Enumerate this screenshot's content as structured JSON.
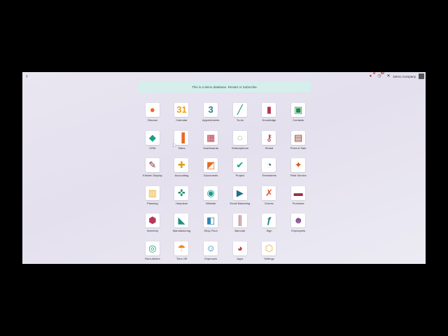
{
  "topbar": {
    "menu_icon": "chevron-right",
    "chat_badge": "6",
    "activity_badge": "12",
    "close_label": "✕",
    "company_name": "Demo Company"
  },
  "banner": {
    "text": "This is a demo database. Restart or Subscribe."
  },
  "apps": [
    {
      "label": "Discuss",
      "glyph": "●",
      "color": "#f26b21",
      "icon": "chat-bubble-icon"
    },
    {
      "label": "Calendar",
      "glyph": "31",
      "color": "#e8a01f",
      "icon": "calendar-icon"
    },
    {
      "label": "Appointments",
      "glyph": "3",
      "color": "#2a7d8c",
      "icon": "appointment-calendar-icon"
    },
    {
      "label": "To-do",
      "glyph": "╱",
      "color": "#1b8a5a",
      "icon": "pencil-check-icon"
    },
    {
      "label": "Knowledge",
      "glyph": "▮",
      "color": "#b8334c",
      "icon": "bookmark-book-icon"
    },
    {
      "label": "Contacts",
      "glyph": "▣",
      "color": "#1d8a4a",
      "icon": "contact-card-icon"
    },
    {
      "label": "CRM",
      "glyph": "◆",
      "color": "#1aa085",
      "icon": "handshake-icon"
    },
    {
      "label": "Sales",
      "glyph": "▐",
      "color": "#e76b1f",
      "icon": "bar-chart-icon"
    },
    {
      "label": "Dashboards",
      "glyph": "▦",
      "color": "#b73a4d",
      "icon": "dashboard-icon"
    },
    {
      "label": "Subscriptions",
      "glyph": "◌",
      "color": "#26a65b",
      "icon": "refresh-cycle-icon"
    },
    {
      "label": "Rental",
      "glyph": "⚷",
      "color": "#a53245",
      "icon": "key-icon"
    },
    {
      "label": "Point of Sale",
      "glyph": "▤",
      "color": "#8b3d2a",
      "icon": "shop-icon"
    },
    {
      "label": "Kitchen Display",
      "glyph": "✎",
      "color": "#7a1d2e",
      "icon": "chef-knife-icon"
    },
    {
      "label": "Accounting",
      "glyph": "✚",
      "color": "#d6a21a",
      "icon": "accounting-icon"
    },
    {
      "label": "Documents",
      "glyph": "◩",
      "color": "#e36b1d",
      "icon": "documents-icon"
    },
    {
      "label": "Project",
      "glyph": "✔",
      "color": "#16a084",
      "icon": "project-check-icon"
    },
    {
      "label": "Timesheets",
      "glyph": "◔",
      "color": "#215f6e",
      "icon": "stopwatch-icon"
    },
    {
      "label": "Field Service",
      "glyph": "✦",
      "color": "#e25a1c",
      "icon": "bolt-icon"
    },
    {
      "label": "Planning",
      "glyph": "▥",
      "color": "#e9a820",
      "icon": "planning-icon"
    },
    {
      "label": "Helpdesk",
      "glyph": "✜",
      "color": "#1b8f6a",
      "icon": "lifebuoy-icon"
    },
    {
      "label": "Website",
      "glyph": "◉",
      "color": "#1a9c8c",
      "icon": "globe-icon"
    },
    {
      "label": "Email Marketing",
      "glyph": "▶",
      "color": "#1f6e8c",
      "icon": "paper-plane-icon"
    },
    {
      "label": "Events",
      "glyph": "✗",
      "color": "#e6522b",
      "icon": "events-ribbon-icon"
    },
    {
      "label": "Purchase",
      "glyph": "▬",
      "color": "#9c2f44",
      "icon": "purchase-card-icon"
    },
    {
      "label": "Inventory",
      "glyph": "⬢",
      "color": "#b6385a",
      "icon": "box-icon"
    },
    {
      "label": "Manufacturing",
      "glyph": "◣",
      "color": "#1f8e82",
      "icon": "factory-icon"
    },
    {
      "label": "Shop Floor",
      "glyph": "◧",
      "color": "#2b86b4",
      "icon": "shop-floor-icon"
    },
    {
      "label": "Barcode",
      "glyph": "║",
      "color": "#8c2a3e",
      "icon": "barcode-icon"
    },
    {
      "label": "Sign",
      "glyph": "ƒ",
      "color": "#1b7f70",
      "icon": "signature-icon"
    },
    {
      "label": "Employees",
      "glyph": "☻",
      "color": "#7f4b8c",
      "icon": "employees-icon"
    },
    {
      "label": "Recruitment",
      "glyph": "◎",
      "color": "#1a9a7a",
      "icon": "magnifier-person-icon"
    },
    {
      "label": "Time Off",
      "glyph": "☂",
      "color": "#e58b1d",
      "icon": "umbrella-icon"
    },
    {
      "label": "Expenses",
      "glyph": "☺",
      "color": "#2a7fb4",
      "icon": "expenses-icon"
    },
    {
      "label": "Apps",
      "glyph": "◕",
      "color": "#c23c4a",
      "icon": "apps-grid-icon"
    },
    {
      "label": "Settings",
      "glyph": "⬡",
      "color": "#e9a820",
      "icon": "gear-icon"
    }
  ]
}
